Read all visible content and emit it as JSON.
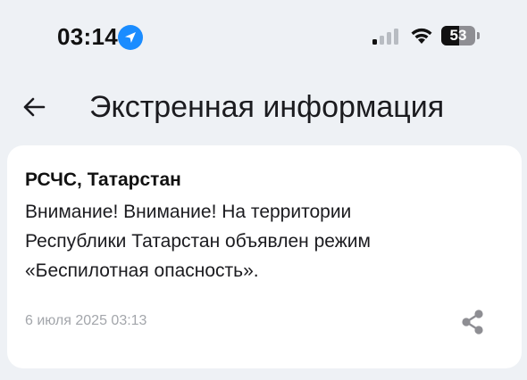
{
  "status_bar": {
    "time": "03:14",
    "location_icon": "location-arrow-icon",
    "signal_icon": "cellular-signal-icon",
    "signal_bars_active": 1,
    "signal_bars_total": 4,
    "wifi_icon": "wifi-icon",
    "battery_icon": "battery-icon",
    "battery_level": "53",
    "battery_fraction": 0.53
  },
  "header": {
    "back_icon": "arrow-left-icon",
    "title": "Экстренная информация"
  },
  "card": {
    "sender": "РСЧС, Татарстан",
    "message_lines": [
      "Внимание! Внимание! На территории",
      "Республики Татарстан объявлен режим",
      "«Беспилотная опасность»."
    ],
    "timestamp": "6 июля 2025 03:13",
    "share_icon": "share-icon"
  },
  "colors": {
    "background": "#eef1f5",
    "card": "#ffffff",
    "accent_blue": "#1a8cff",
    "muted_text": "#a3a6ab",
    "icon_gray": "#8e8e93"
  }
}
